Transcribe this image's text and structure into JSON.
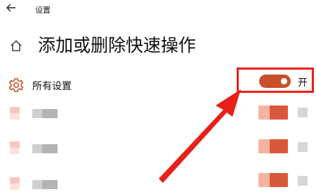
{
  "window": {
    "title": "设置"
  },
  "header": {
    "back_icon": "back-arrow-icon",
    "page_title": "添加或删除快速操作",
    "home_icon": "home-icon"
  },
  "settings": {
    "all_settings": {
      "label": "所有设置",
      "icon": "gear-icon",
      "toggle_on": true,
      "state_label": "开"
    }
  },
  "colors": {
    "accent": "#c8502b",
    "highlight": "#e8201a"
  }
}
